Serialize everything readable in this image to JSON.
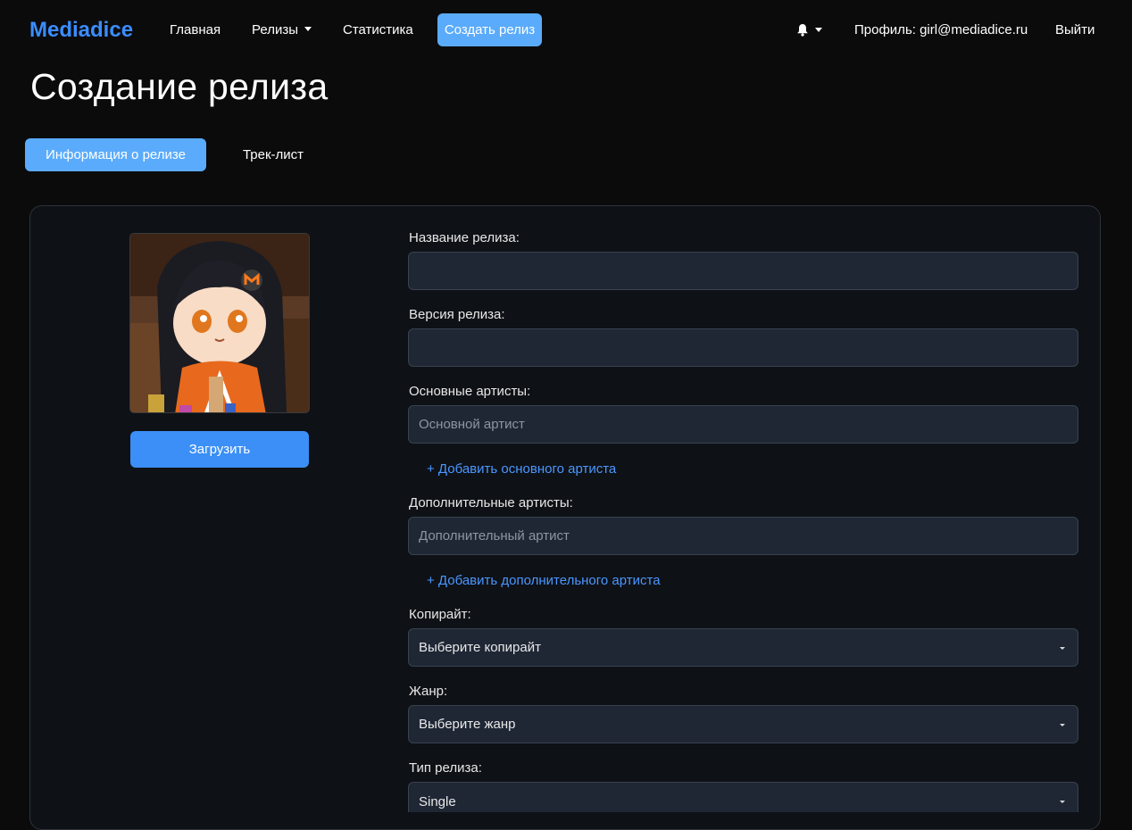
{
  "nav": {
    "brand": "Mediadice",
    "home": "Главная",
    "releases": "Релизы",
    "stats": "Статистика",
    "create": "Создать релиз",
    "profile": "Профиль: girl@mediadice.ru",
    "logout": "Выйти"
  },
  "page": {
    "title": "Создание релиза"
  },
  "tabs": {
    "info": "Информация о релизе",
    "tracklist": "Трек-лист"
  },
  "cover": {
    "upload_label": "Загрузить"
  },
  "form": {
    "release_name": {
      "label": "Название релиза:",
      "value": ""
    },
    "release_version": {
      "label": "Версия релиза:",
      "value": ""
    },
    "main_artists": {
      "label": "Основные артисты:",
      "placeholder": "Основной артист",
      "add": "+ Добавить основного артиста"
    },
    "extra_artists": {
      "label": "Дополнительные артисты:",
      "placeholder": "Дополнительный артист",
      "add": "+ Добавить дополнительного артиста"
    },
    "copyright": {
      "label": "Копирайт:",
      "value": "Выберите копирайт"
    },
    "genre": {
      "label": "Жанр:",
      "value": "Выберите жанр"
    },
    "release_type": {
      "label": "Тип релиза:",
      "value": "Single"
    }
  },
  "colors": {
    "accent": "#5aabfb",
    "brand": "#3a8dff",
    "link": "#4b97ff",
    "field_bg": "#1f2735"
  }
}
